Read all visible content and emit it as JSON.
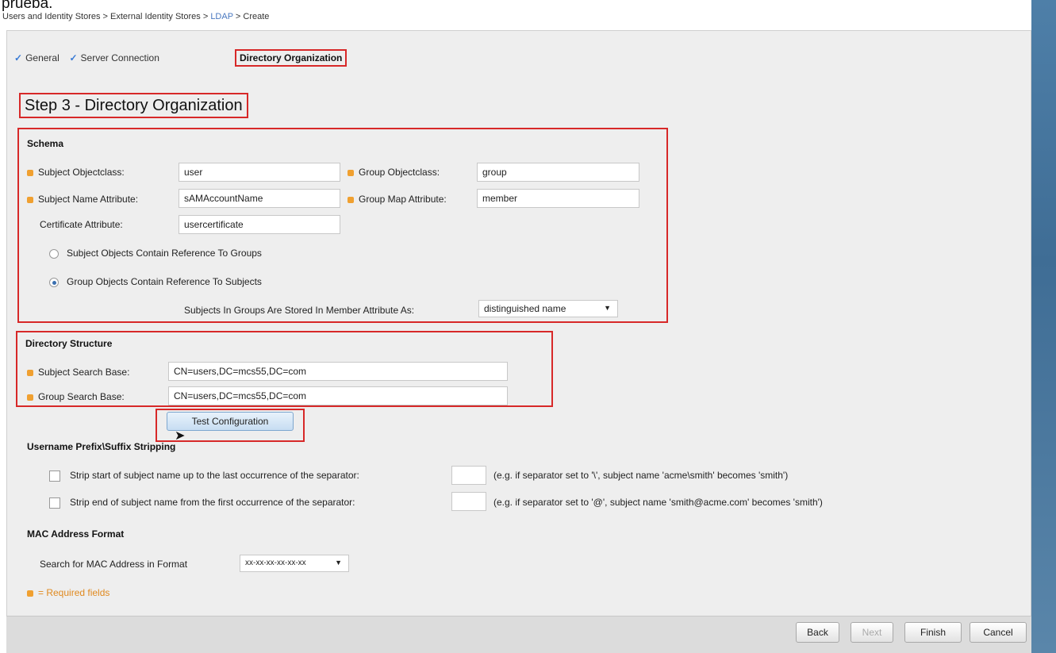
{
  "top_label": "prueba.",
  "breadcrumb": {
    "part1": "Users and Identity Stores > External Identity Stores > ",
    "link": "LDAP",
    "part2": " > Create"
  },
  "wizard": {
    "step1": "General",
    "step2": "Server Connection",
    "step3": "Directory Organization",
    "check_icon": "✓"
  },
  "step_title": "Step 3 - Directory Organization",
  "schema": {
    "title": "Schema",
    "subject_objectclass_label": "Subject Objectclass:",
    "subject_objectclass_value": "user",
    "group_objectclass_label": "Group Objectclass:",
    "group_objectclass_value": "group",
    "subject_name_attr_label": "Subject Name Attribute:",
    "subject_name_attr_value": "sAMAccountName",
    "group_map_attr_label": "Group Map Attribute:",
    "group_map_attr_value": "member",
    "cert_attr_label": "Certificate Attribute:",
    "cert_attr_value": "usercertificate",
    "radio1_label": "Subject Objects Contain Reference To Groups",
    "radio2_label": "Group Objects Contain Reference To Subjects",
    "stored_as_label": "Subjects In Groups Are Stored In Member Attribute As:",
    "stored_as_value": "distinguished name"
  },
  "directory_structure": {
    "title": "Directory Structure",
    "subject_search_base_label": "Subject Search Base:",
    "subject_search_base_value": "CN=users,DC=mcs55,DC=com",
    "group_search_base_label": "Group Search Base:",
    "group_search_base_value": "CN=users,DC=mcs55,DC=com"
  },
  "test_configuration_label": "Test Configuration",
  "prefix_suffix": {
    "title": "Username Prefix\\Suffix Stripping",
    "strip_start_label": "Strip start of subject name up to the last occurrence of the separator:",
    "strip_start_hint": "(e.g. if separator set to '\\', subject name 'acme\\smith' becomes 'smith')",
    "strip_end_label": "Strip end of subject name from the first occurrence of the separator:",
    "strip_end_hint": "(e.g. if separator set to '@', subject name 'smith@acme.com' becomes 'smith')"
  },
  "mac": {
    "title": "MAC Address Format",
    "search_label": "Search for MAC Address in Format",
    "search_value": "xx-xx-xx-xx-xx-xx"
  },
  "required_note": "= Required fields",
  "footer": {
    "back": "Back",
    "next": "Next",
    "finish": "Finish",
    "cancel": "Cancel"
  },
  "colors": {
    "highlight": "#d72828",
    "required": "#f0a030",
    "accent": "#3a7bd5"
  }
}
